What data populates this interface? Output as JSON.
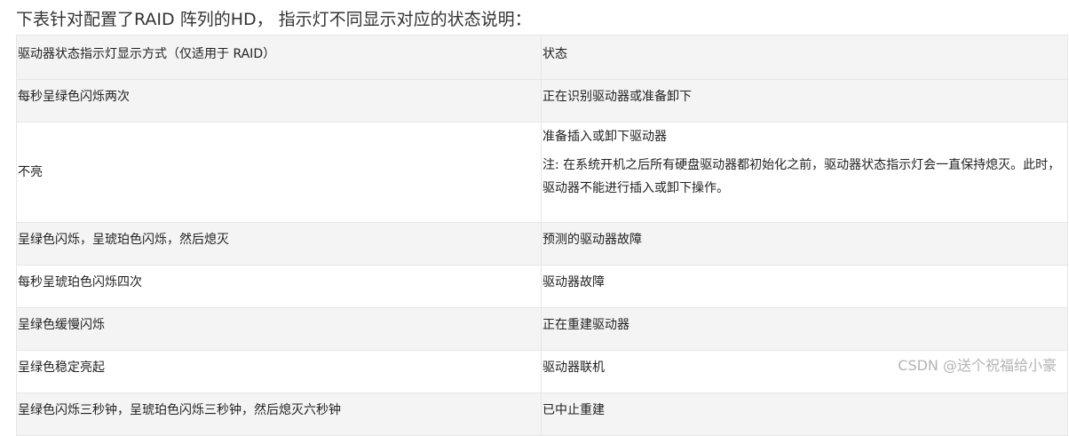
{
  "intro": "下表针对配置了RAID 阵列的HD， 指示灯不同显示对应的状态说明：",
  "table": {
    "header": {
      "col1": "驱动器状态指示灯显示方式（仅适用于 RAID）",
      "col2": "状态"
    },
    "rows": [
      {
        "display": "每秒呈绿色闪烁两次",
        "status": "正在识别驱动器或准备卸下"
      },
      {
        "display": "不亮",
        "status": "准备插入或卸下驱动器",
        "note": "注: 在系统开机之后所有硬盘驱动器都初始化之前，驱动器状态指示灯会一直保持熄灭。此时，驱动器不能进行插入或卸下操作。"
      },
      {
        "display": "呈绿色闪烁，呈琥珀色闪烁，然后熄灭",
        "status": "预测的驱动器故障"
      },
      {
        "display": "每秒呈琥珀色闪烁四次",
        "status": "驱动器故障"
      },
      {
        "display": "呈绿色缓慢闪烁",
        "status": "正在重建驱动器"
      },
      {
        "display": "呈绿色稳定亮起",
        "status": "驱动器联机"
      },
      {
        "display": "呈绿色闪烁三秒钟，呈琥珀色闪烁三秒钟，然后熄灭六秒钟",
        "status": "已中止重建"
      }
    ]
  },
  "watermark": "CSDN @送个祝福给小豪"
}
